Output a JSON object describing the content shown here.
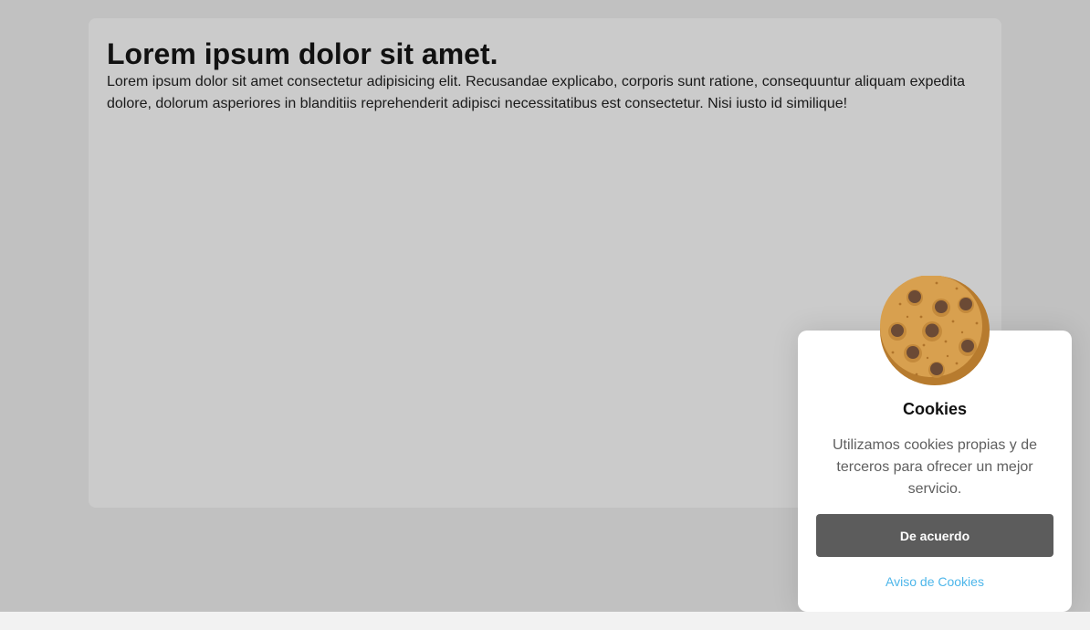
{
  "content": {
    "heading": "Lorem ipsum dolor sit amet.",
    "paragraph": "Lorem ipsum dolor sit amet consectetur adipisicing elit. Recusandae explicabo, corporis sunt ratione, consequuntur aliquam expedita dolore, dolorum asperiores in blanditiis reprehenderit adipisci necessitatibus est consectetur. Nisi iusto id similique!"
  },
  "cookie_banner": {
    "icon": "cookie-icon",
    "title": "Cookies",
    "message": "Utilizamos cookies propias y de terceros para ofrecer un mejor servicio.",
    "accept_label": "De acuerdo",
    "notice_link_label": "Aviso de Cookies"
  },
  "colors": {
    "page_background": "#c1c1c1",
    "card_background": "#cbcbcb",
    "accept_button": "#5c5c5c",
    "link": "#4db6ea"
  }
}
